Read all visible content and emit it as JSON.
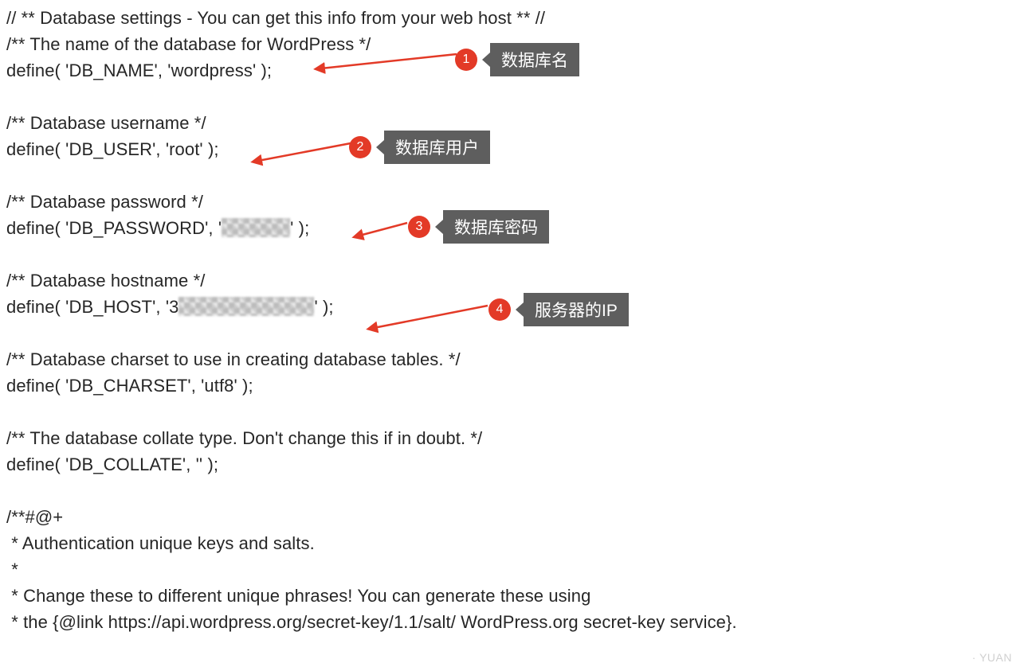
{
  "code": {
    "line1": "// ** Database settings - You can get this info from your web host ** //",
    "line2": "/** The name of the database for WordPress */",
    "line3": "define( 'DB_NAME', 'wordpress' );",
    "line4": "",
    "line5": "/** Database username */",
    "line6_a": "define( 'DB_USER', 'root' );",
    "line7": "",
    "line8": "/** Database password */",
    "line9_a": "define( 'DB_PASSWORD', '",
    "line9_c": "' );",
    "line10": "",
    "line11": "/** Database hostname */",
    "line12_a": "define( 'DB_HOST', '3",
    "line12_c": "' );",
    "line13": "",
    "line14": "/** Database charset to use in creating database tables. */",
    "line15": "define( 'DB_CHARSET', 'utf8' );",
    "line16": "",
    "line17": "/** The database collate type. Don't change this if in doubt. */",
    "line18": "define( 'DB_COLLATE', '' );",
    "line19": "",
    "line20": "/**#@+",
    "line21": " * Authentication unique keys and salts.",
    "line22": " *",
    "line23": " * Change these to different unique phrases! You can generate these using",
    "line24": " * the {@link https://api.wordpress.org/secret-key/1.1/salt/ WordPress.org secret-key service}."
  },
  "annotations": {
    "a1": {
      "num": "1",
      "label": "数据库名"
    },
    "a2": {
      "num": "2",
      "label": "数据库用户"
    },
    "a3": {
      "num": "3",
      "label": "数据库密码"
    },
    "a4": {
      "num": "4",
      "label": "服务器的IP"
    }
  },
  "watermark": "                         · YUAN"
}
